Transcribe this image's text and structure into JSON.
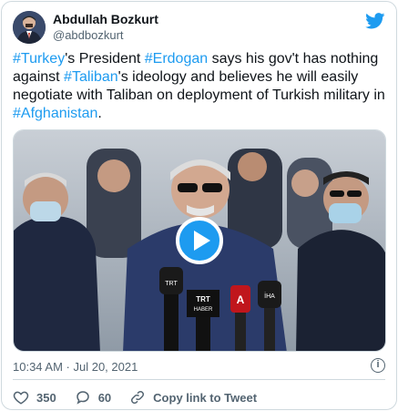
{
  "author": {
    "name": "Abdullah Bozkurt",
    "handle": "@abdbozkurt"
  },
  "tweet": {
    "parts": [
      {
        "text": "#Turkey",
        "tag": true
      },
      {
        "text": "'s President ",
        "tag": false
      },
      {
        "text": "#Erdogan",
        "tag": true
      },
      {
        "text": " says his gov't has nothing against ",
        "tag": false
      },
      {
        "text": "#Taliban",
        "tag": true
      },
      {
        "text": "'s ideology and believes he will easily negotiate with Taliban on deployment of Turkish military in ",
        "tag": false
      },
      {
        "text": "#Afghanistan",
        "tag": true
      },
      {
        "text": ".",
        "tag": false
      }
    ]
  },
  "media": {
    "mic_labels": [
      "TRT",
      "HABER",
      "A",
      "İHA"
    ]
  },
  "meta": {
    "timestamp": "10:34 AM · Jul 20, 2021",
    "info_icon": "i"
  },
  "actions": {
    "likes": "350",
    "replies": "60",
    "copy_link": "Copy link to Tweet"
  },
  "colors": {
    "accent": "#1d9bf0",
    "like": "#f91880"
  }
}
